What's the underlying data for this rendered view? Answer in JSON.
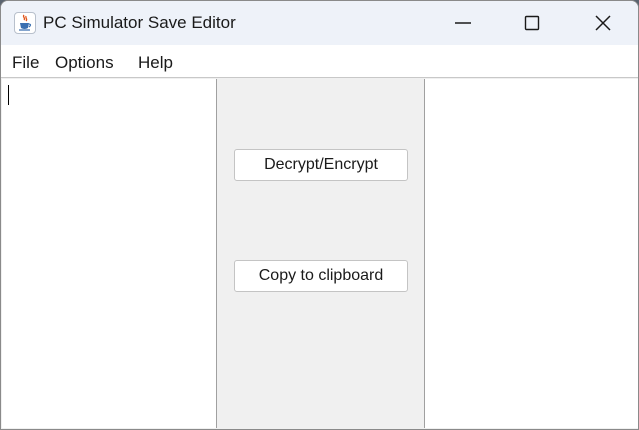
{
  "window": {
    "title": "PC Simulator Save Editor",
    "icon": "java-cup-icon",
    "controls": [
      "minimize-icon",
      "maximize-icon",
      "close-icon"
    ]
  },
  "menu": {
    "file": "File",
    "options": "Options",
    "help": "Help"
  },
  "main": {
    "input_text": "",
    "output_text": "",
    "decrypt_button": "Decrypt/Encrypt",
    "copy_button": "Copy to clipboard"
  }
}
